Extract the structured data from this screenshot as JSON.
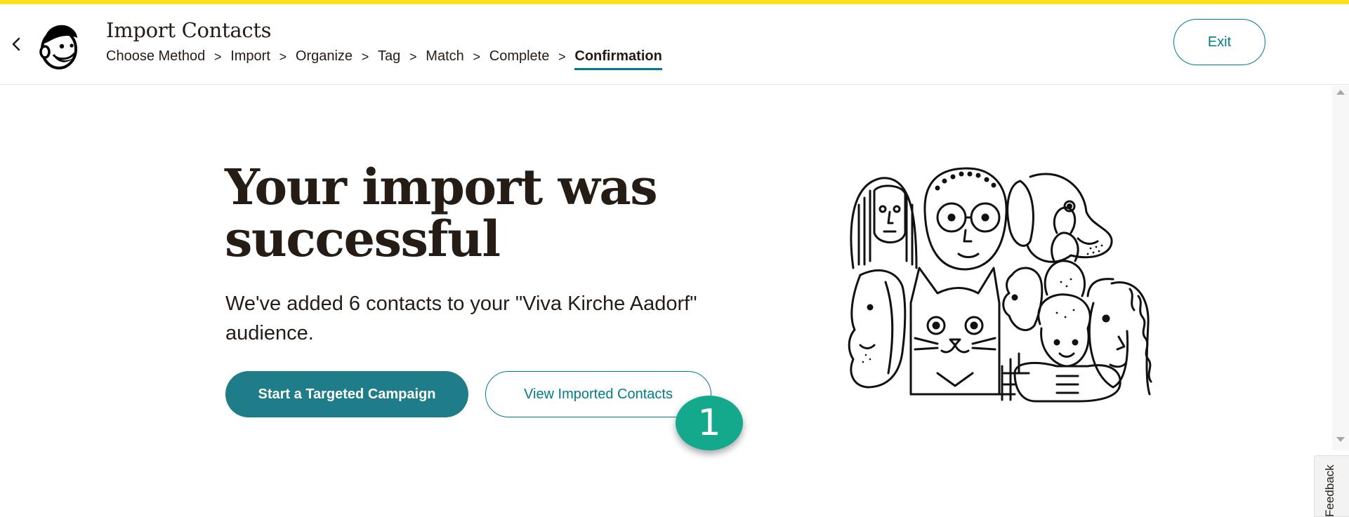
{
  "header": {
    "title": "Import Contacts",
    "exit_label": "Exit",
    "breadcrumb": {
      "items": [
        {
          "label": "Choose Method"
        },
        {
          "label": "Import"
        },
        {
          "label": "Organize"
        },
        {
          "label": "Tag"
        },
        {
          "label": "Match"
        },
        {
          "label": "Complete"
        },
        {
          "label": "Confirmation"
        }
      ],
      "separator": ">",
      "active": "Confirmation"
    }
  },
  "main": {
    "headline": "Your import was successful",
    "message": "We've added 6 contacts to your \"Viva Kirche Aadorf\" audience.",
    "primary_button": "Start a Targeted Campaign",
    "secondary_button": "View Imported Contacts"
  },
  "annotation": {
    "step_number": "1"
  },
  "feedback": {
    "label": "Feedback"
  },
  "icons": {
    "back": "chevron-left-icon",
    "logo": "mailchimp-freddie-logo",
    "scroll_up": "triangle-up-icon",
    "scroll_down": "triangle-down-icon"
  },
  "colors": {
    "top_accent": "#ffe01b",
    "brand_teal": "#007c89",
    "primary_button_bg": "#1f7c89",
    "marker_green": "#14a98d",
    "text": "#241c15"
  }
}
